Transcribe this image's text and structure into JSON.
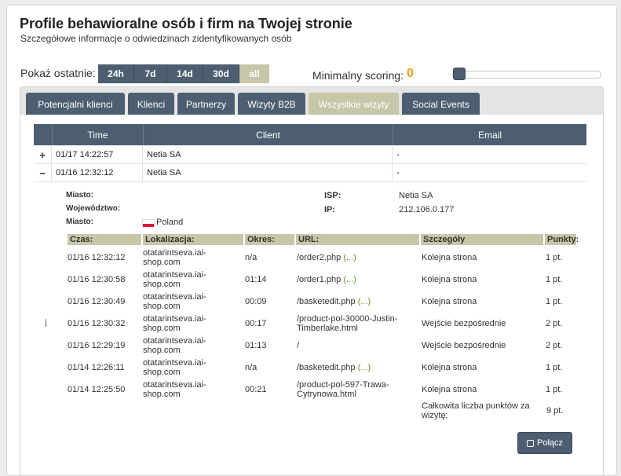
{
  "header": {
    "title": "Profile behawioralne osób i firm na Twojej stronie",
    "subtitle": "Szczegółowe informacje o odwiedzinach zidentyfikowanych osób"
  },
  "filters": {
    "range_label": "Pokaż ostatnie:",
    "ranges": [
      "24h",
      "7d",
      "14d",
      "30d",
      "all"
    ],
    "active_range": "all",
    "scoring_label": "Minimalny scoring:",
    "scoring_value": "0"
  },
  "tabs": [
    {
      "label": "Potencjalni klienci"
    },
    {
      "label": "Klienci"
    },
    {
      "label": "Partnerzy"
    },
    {
      "label": "Wizyty B2B"
    },
    {
      "label": "Wszystkie wizyty"
    },
    {
      "label": "Social Events"
    }
  ],
  "active_tab": "Wszystkie wizyty",
  "table": {
    "columns": [
      "Time",
      "Client",
      "Email"
    ],
    "rows": [
      {
        "toggle": "+",
        "time": "01/17 14:22:57",
        "client": "Netia SA",
        "email": "-"
      },
      {
        "toggle": "−",
        "time": "01/16 12:32:12",
        "client": "Netia SA",
        "email": "-"
      }
    ]
  },
  "detail": {
    "city_label": "Miasto:",
    "province_label": "Województwo:",
    "country_label": "Miasto:",
    "country_value": "Poland",
    "isp_label": "ISP:",
    "isp_value": "Netia SA",
    "ip_label": "IP:",
    "ip_value": "212.106.0.177",
    "visits_columns": [
      "Czas:",
      "Lokalizacja:",
      "Okres:",
      "URL:",
      "Szczegóły",
      "Punkty:"
    ],
    "visits": [
      {
        "time": "01/16 12:32:12",
        "location": "otatarintseva.iai-shop.com",
        "period": "n/a",
        "url": "/order2.php",
        "more": "(...)",
        "details": "Kolejna strona",
        "points": "1 pt."
      },
      {
        "time": "01/16 12:30:58",
        "location": "otatarintseva.iai-shop.com",
        "period": "01:14",
        "url": "/order1.php",
        "more": "(...)",
        "details": "Kolejna strona",
        "points": "1 pt."
      },
      {
        "time": "01/16 12:30:49",
        "location": "otatarintseva.iai-shop.com",
        "period": "00:09",
        "url": "/basketedit.php",
        "more": "(...)",
        "details": "Kolejna strona",
        "points": "1 pt."
      },
      {
        "time": "01/16 12:30:32",
        "location": "otatarintseva.iai-shop.com",
        "period": "00:17",
        "url": "/product-pol-30000-Justin-Timberlake.html",
        "more": "",
        "details": "Wejście bezpośrednie",
        "points": "2 pt."
      },
      {
        "time": "01/16 12:29:19",
        "location": "otatarintseva.iai-shop.com",
        "period": "01:13",
        "url": "/",
        "more": "",
        "details": "Wejście bezpośrednie",
        "points": "2 pt."
      },
      {
        "time": "01/14 12:26:11",
        "location": "otatarintseva.iai-shop.com",
        "period": "n/a",
        "url": "/basketedit.php",
        "more": "(...)",
        "details": "Kolejna strona",
        "points": "1 pt."
      },
      {
        "time": "01/14 12:25:50",
        "location": "otatarintseva.iai-shop.com",
        "period": "00:21",
        "url": "/product-pol-597-Trawa-Cytrynowa.html",
        "more": "",
        "details": "Kolejna strona",
        "points": "1 pt."
      }
    ],
    "total_label": "Całkowita liczba punktów za wizytę:",
    "total_value": "9 pt.",
    "connect_label": "Połącz"
  },
  "colors": {
    "accent": "#4d5e70",
    "active": "#c8c6a8",
    "score": "#f39a1f",
    "link": "#5a9a1e"
  }
}
